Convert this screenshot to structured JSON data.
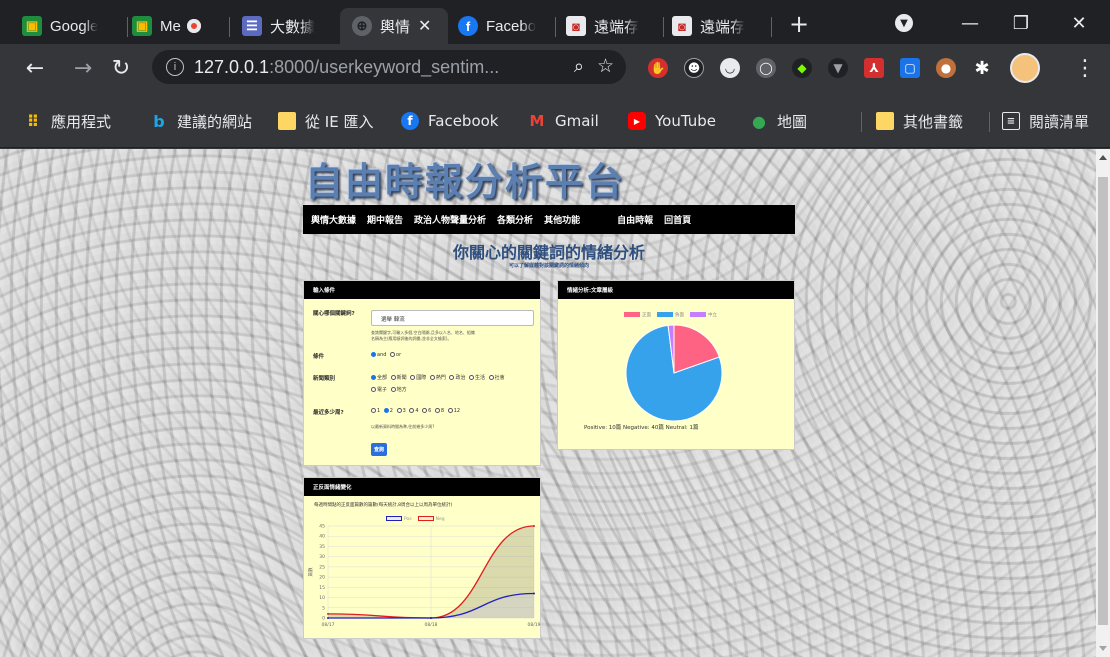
{
  "browser": {
    "tabs": [
      {
        "label": "Google",
        "icon": "google-classroom-icon"
      },
      {
        "label": "Me",
        "icon": "meet-icon"
      },
      {
        "label": "",
        "icon": "recording-icon"
      },
      {
        "label": "大數據",
        "icon": "list-app-icon"
      },
      {
        "label": "輿情",
        "icon": "globe-icon",
        "active": true
      },
      {
        "label": "Facebo",
        "icon": "facebook-icon"
      },
      {
        "label": "遠端存",
        "icon": "remote-storage-icon"
      },
      {
        "label": "遠端存",
        "icon": "remote-storage-icon"
      }
    ],
    "address": {
      "host": "127.0.0.1",
      "path": ":8000/userkeyword_sentim..."
    },
    "bookmarks": [
      {
        "label": "應用程式",
        "icon": "apps-grid-icon"
      },
      {
        "label": "建議的網站",
        "icon": "bing-icon"
      },
      {
        "label": "從 IE 匯入",
        "icon": "folder-icon"
      },
      {
        "label": "Facebook",
        "icon": "facebook-icon"
      },
      {
        "label": "Gmail",
        "icon": "gmail-icon"
      },
      {
        "label": "YouTube",
        "icon": "youtube-icon"
      },
      {
        "label": "地圖",
        "icon": "maps-pin-icon"
      }
    ],
    "bookmarks_right": [
      {
        "label": "其他書籤",
        "icon": "folder-icon"
      },
      {
        "label": "閱讀清單",
        "icon": "reading-list-icon"
      }
    ]
  },
  "site": {
    "title": "自由時報分析平台",
    "nav": [
      "輿情大數據",
      "期中報告",
      "政治人物聲量分析",
      "各類分析",
      "其他功能",
      "自由時報",
      "回首頁"
    ],
    "heading": "你關心的關鍵詞的情緒分析",
    "subheading": "可以了解媒體對該關鍵詞的情緒傾向"
  },
  "input_panel": {
    "title": "輸入條件",
    "keyword_label": "關心哪個關鍵詞?",
    "keyword_value": "選舉 韓流",
    "keyword_hint_1": "查詢關鍵字,可輸入多個,空白隔開,且多以人名、地名、組織",
    "keyword_hint_2": "名稱為主(應用斷詞後的詞彙,並非全文檢索)。",
    "condition_label": "條件",
    "condition_options": [
      "and",
      "or"
    ],
    "category_label": "新聞類別",
    "category_options_row1": [
      "全部",
      "新聞",
      "國際",
      "熱門",
      "政治",
      "生活",
      "社會"
    ],
    "category_options_row2": [
      "電子",
      "地方"
    ],
    "weeks_label": "最近多少周?",
    "weeks_options": [
      "1",
      "2",
      "3",
      "4",
      "6",
      "8",
      "12"
    ],
    "weeks_hint": "以最新資料時間為準,往前幾多少周?",
    "query_button": "查詢"
  },
  "pie_panel": {
    "title": "情緒分析:文章層級",
    "legend": [
      "正面",
      "負面",
      "中立"
    ],
    "caption": "Positive: 10篇 Negative: 40篇 Neutral: 1篇"
  },
  "line_panel": {
    "title": "正反面情緒變化",
    "caption": "每週時間點的正反面篇數的篇數(每天統計,8周合以上以周為單位統計)",
    "ylabel": "篇數",
    "legend": [
      "Pos",
      "Neg"
    ]
  },
  "colors": {
    "positive": "#ff6384",
    "negative": "#36a2eb",
    "neutral": "#c77dff",
    "line_pos": "#2020c0",
    "line_neg": "#e02020"
  },
  "chart_data": [
    {
      "type": "pie",
      "title": "",
      "categories": [
        "正面",
        "負面",
        "中立"
      ],
      "values": [
        10,
        40,
        1
      ]
    },
    {
      "type": "line",
      "title": "",
      "ylabel": "篇數",
      "x": [
        "08/17",
        "08/18",
        "08/19"
      ],
      "ylim": [
        0,
        45
      ],
      "yticks": [
        0,
        5,
        10,
        15,
        20,
        25,
        30,
        35,
        40,
        45
      ],
      "series": [
        {
          "name": "Pos",
          "values": [
            0,
            0,
            12
          ]
        },
        {
          "name": "Neg",
          "values": [
            2,
            0,
            45
          ]
        }
      ]
    }
  ]
}
